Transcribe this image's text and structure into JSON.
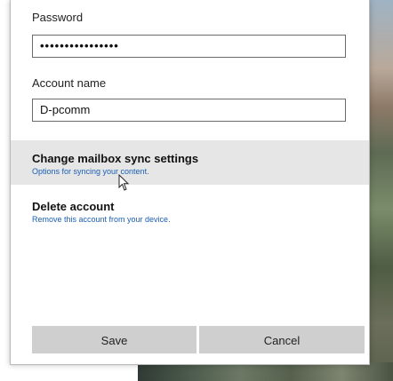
{
  "form": {
    "password_label": "Password",
    "password_value": "••••••••••••••••",
    "account_name_label": "Account name",
    "account_name_value": "D-pcomm"
  },
  "options": {
    "sync": {
      "title": "Change mailbox sync settings",
      "subtitle": "Options for syncing your content."
    },
    "delete": {
      "title": "Delete account",
      "subtitle": "Remove this account from your device."
    }
  },
  "buttons": {
    "save": "Save",
    "cancel": "Cancel"
  },
  "colors": {
    "link_blue": "#1a5fb4",
    "hover_gray": "#e6e6e6",
    "button_gray": "#cfcfcf"
  }
}
